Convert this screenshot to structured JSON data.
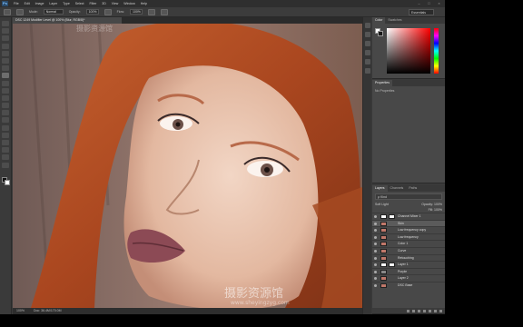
{
  "app": {
    "logo": "Ps"
  },
  "menus": [
    "File",
    "Edit",
    "Image",
    "Layer",
    "Type",
    "Select",
    "Filter",
    "3D",
    "View",
    "Window",
    "Help"
  ],
  "window_controls": [
    "–",
    "□",
    "×"
  ],
  "options_bar": {
    "mode_label": "Mode:",
    "mode_value": "Normal",
    "opacity_label": "Opacity:",
    "opacity_value": "100%",
    "flow_label": "Flow:",
    "flow_value": "100%",
    "workspace": "Essentials"
  },
  "document_tab": {
    "title": "DSC 1249 Modifier Level @ 100% (Blur, RGB/8)*"
  },
  "status_bar": {
    "zoom": "100%",
    "doc_size": "Doc: 36.4M/170.0M"
  },
  "panels": {
    "color": {
      "tabs": [
        "Color",
        "Swatches"
      ]
    },
    "properties": {
      "tabs": [
        "Properties"
      ],
      "empty_text": "No Properties"
    },
    "layers": {
      "tabs": [
        "Layers",
        "Channels",
        "Paths"
      ],
      "kind_filter": "ρ Kind",
      "blend_mode": "Soft Light",
      "opacity": "Opacity: 100%",
      "fill": "Fill: 100%",
      "rows": [
        {
          "name": "Channel Mixer 1",
          "thumb": "white",
          "has_mask": true,
          "selected": false
        },
        {
          "name": "Skin",
          "thumb": "skin",
          "has_mask": false,
          "selected": true
        },
        {
          "name": "Low frequency copy",
          "thumb": "skin",
          "has_mask": false,
          "selected": false
        },
        {
          "name": "Low frequency",
          "thumb": "skin",
          "has_mask": false,
          "selected": false
        },
        {
          "name": "Color 1",
          "thumb": "skin",
          "has_mask": false,
          "selected": false
        },
        {
          "name": "Curve",
          "thumb": "skin",
          "has_mask": false,
          "selected": false
        },
        {
          "name": "Retouching",
          "thumb": "skin",
          "has_mask": false,
          "selected": false
        },
        {
          "name": "Layer 1",
          "thumb": "white",
          "has_mask": true,
          "selected": false
        },
        {
          "name": "Purple",
          "thumb": "gray",
          "has_mask": false,
          "selected": false
        },
        {
          "name": "Layer 2",
          "thumb": "skin",
          "has_mask": false,
          "selected": false
        },
        {
          "name": "DSC Base",
          "thumb": "skin",
          "has_mask": false,
          "selected": false
        }
      ]
    }
  },
  "watermarks": {
    "top": "摄影资源馆",
    "bottom": "摄影资源馆",
    "url": "www.sheyingzyg.com"
  },
  "colors": {
    "hair": "#b8532a",
    "skin": "#e8c3ad",
    "lips": "#8c4a55",
    "background": "#8a6a5e"
  }
}
